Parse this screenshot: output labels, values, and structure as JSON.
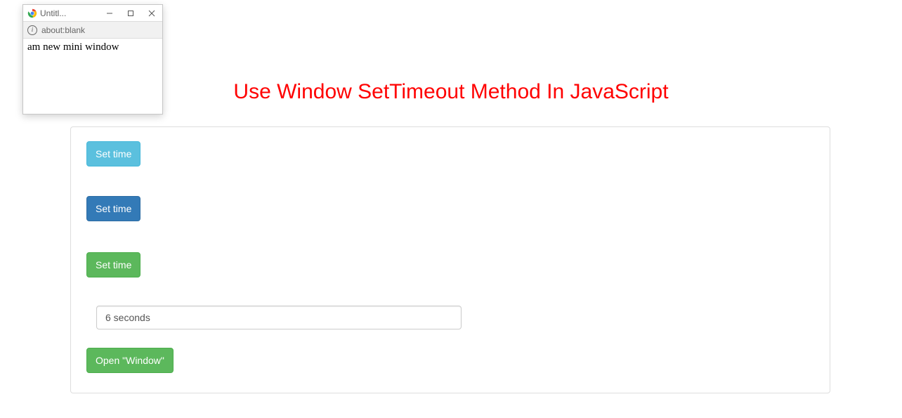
{
  "popup": {
    "tab_title": "Untitl...",
    "address": "about:blank",
    "content": "am new mini window"
  },
  "heading": "Use Window SetTimeout Method In JavaScript",
  "buttons": {
    "set_time_1": "Set time",
    "set_time_2": "Set time",
    "set_time_3": "Set time",
    "open_window": "Open \"Window\""
  },
  "input": {
    "value": "6 seconds"
  },
  "colors": {
    "heading": "#ff0000",
    "info": "#5bc0de",
    "primary": "#337ab7",
    "success": "#5cb85c"
  }
}
